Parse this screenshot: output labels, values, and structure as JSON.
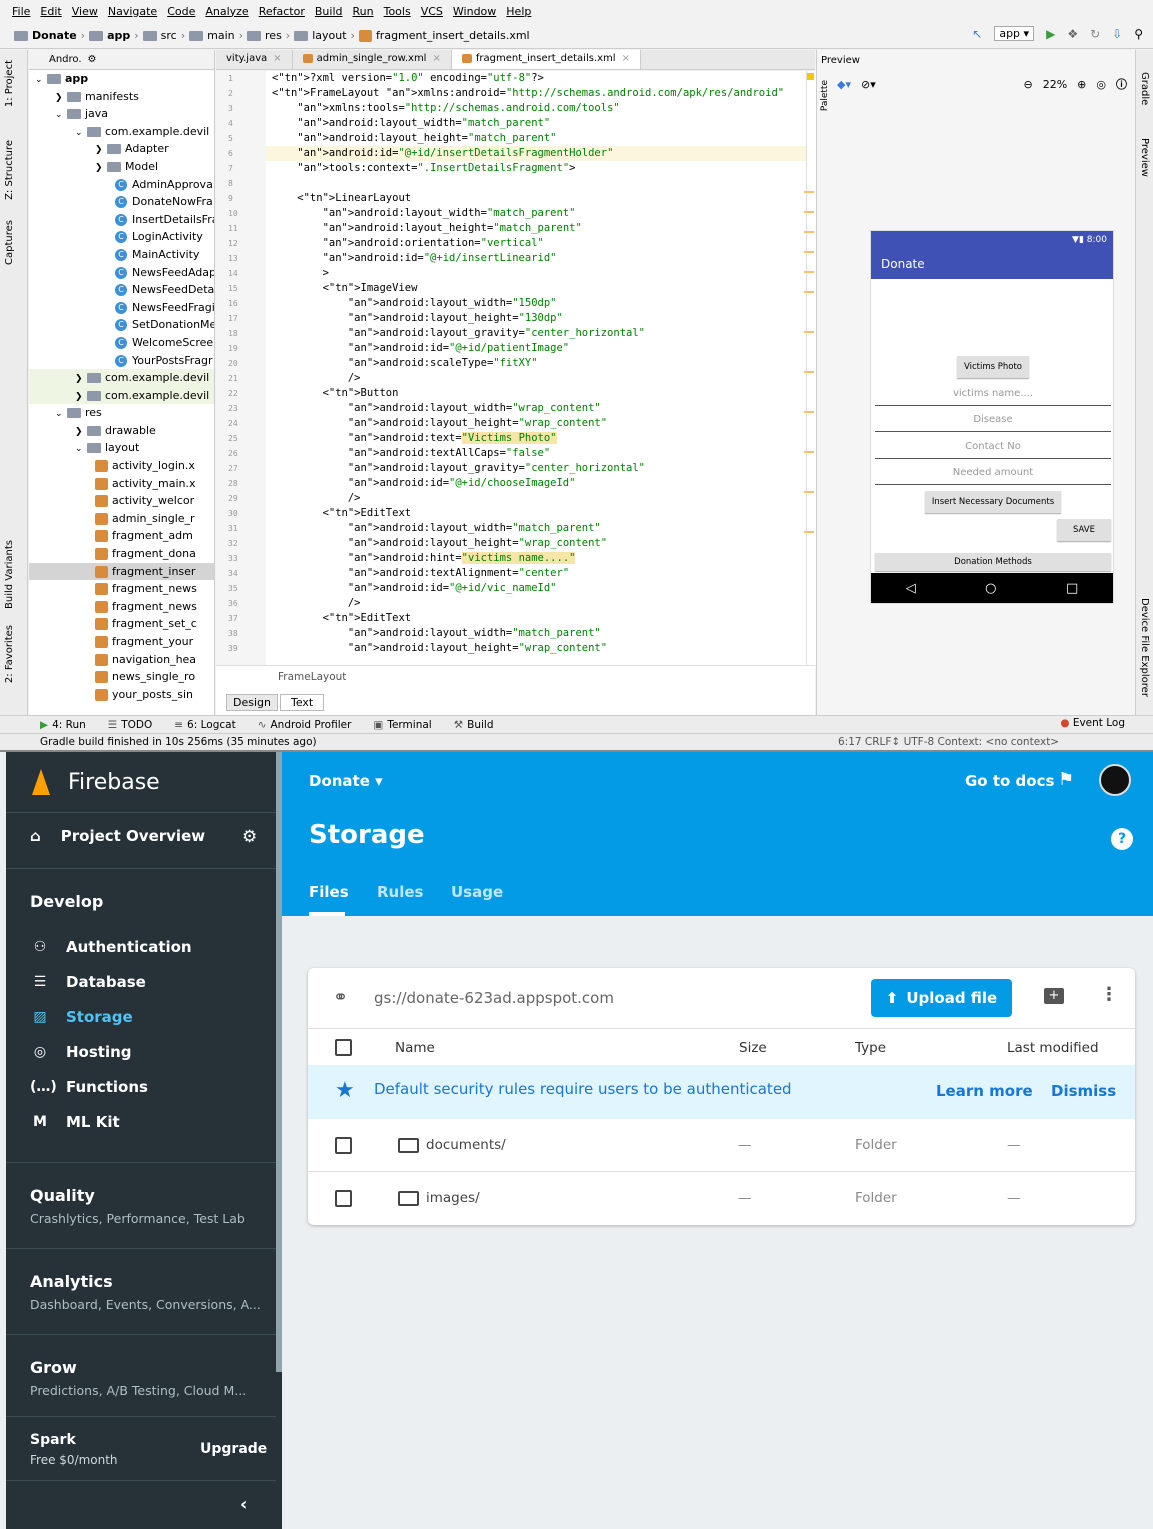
{
  "ide": {
    "menu": [
      "File",
      "Edit",
      "View",
      "Navigate",
      "Code",
      "Analyze",
      "Refactor",
      "Build",
      "Run",
      "Tools",
      "VCS",
      "Window",
      "Help"
    ],
    "breadcrumb": [
      "Donate",
      "app",
      "src",
      "main",
      "res",
      "layout",
      "fragment_insert_details.xml"
    ],
    "run_config": "app",
    "left_tools": [
      "1: Project",
      "Z: Structure",
      "Captures",
      "Build Variants",
      "2: Favorites"
    ],
    "right_tools": [
      "Gradle",
      "Preview",
      "Device File Explorer"
    ],
    "project_header": "Andro.",
    "tree": [
      {
        "label": "app",
        "d": 0,
        "t": "fold"
      },
      {
        "label": "manifests",
        "d": 1,
        "t": "fold"
      },
      {
        "label": "java",
        "d": 1,
        "t": "fold"
      },
      {
        "label": "com.example.devil",
        "d": 2,
        "t": "fold"
      },
      {
        "label": "Adapter",
        "d": 3,
        "t": "fold"
      },
      {
        "label": "Model",
        "d": 3,
        "t": "fold"
      },
      {
        "label": "AdminApprova",
        "d": 4,
        "t": "class"
      },
      {
        "label": "DonateNowFra",
        "d": 4,
        "t": "class"
      },
      {
        "label": "InsertDetailsFra",
        "d": 4,
        "t": "class"
      },
      {
        "label": "LoginActivity",
        "d": 4,
        "t": "class"
      },
      {
        "label": "MainActivity",
        "d": 4,
        "t": "class"
      },
      {
        "label": "NewsFeedAdap",
        "d": 4,
        "t": "class"
      },
      {
        "label": "NewsFeedDeta",
        "d": 4,
        "t": "class"
      },
      {
        "label": "NewsFeedFragi",
        "d": 4,
        "t": "class"
      },
      {
        "label": "SetDonationMe",
        "d": 4,
        "t": "class"
      },
      {
        "label": "WelcomeScree",
        "d": 4,
        "t": "class"
      },
      {
        "label": "YourPostsFragr",
        "d": 4,
        "t": "class"
      },
      {
        "label": "com.example.devil",
        "d": 2,
        "t": "fold",
        "hl": true
      },
      {
        "label": "com.example.devil",
        "d": 2,
        "t": "fold",
        "hl": true
      },
      {
        "label": "res",
        "d": 1,
        "t": "fold"
      },
      {
        "label": "drawable",
        "d": 2,
        "t": "fold"
      },
      {
        "label": "layout",
        "d": 2,
        "t": "fold"
      },
      {
        "label": "activity_login.x",
        "d": 3,
        "t": "xml"
      },
      {
        "label": "activity_main.x",
        "d": 3,
        "t": "xml"
      },
      {
        "label": "activity_welcor",
        "d": 3,
        "t": "xml"
      },
      {
        "label": "admin_single_r",
        "d": 3,
        "t": "xml"
      },
      {
        "label": "fragment_adm",
        "d": 3,
        "t": "xml"
      },
      {
        "label": "fragment_dona",
        "d": 3,
        "t": "xml"
      },
      {
        "label": "fragment_inser",
        "d": 3,
        "t": "xml",
        "sel": true
      },
      {
        "label": "fragment_news",
        "d": 3,
        "t": "xml"
      },
      {
        "label": "fragment_news",
        "d": 3,
        "t": "xml"
      },
      {
        "label": "fragment_set_c",
        "d": 3,
        "t": "xml"
      },
      {
        "label": "fragment_your",
        "d": 3,
        "t": "xml"
      },
      {
        "label": "navigation_hea",
        "d": 3,
        "t": "xml"
      },
      {
        "label": "news_single_ro",
        "d": 3,
        "t": "xml"
      },
      {
        "label": "your_posts_sin",
        "d": 3,
        "t": "xml"
      }
    ],
    "tabs": [
      "vity.java",
      "admin_single_row.xml",
      "fragment_insert_details.xml"
    ],
    "active_tab": 2,
    "code": [
      "<?xml version=\"1.0\" encoding=\"utf-8\"?>",
      "<FrameLayout xmlns:android=\"http://schemas.android.com/apk/res/android\"",
      "    xmlns:tools=\"http://schemas.android.com/tools\"",
      "    android:layout_width=\"match_parent\"",
      "    android:layout_height=\"match_parent\"",
      "    android:id=\"@+id/insertDetailsFragmentHolder\"",
      "    tools:context=\".InsertDetailsFragment\">",
      "",
      "    <LinearLayout",
      "        android:layout_width=\"match_parent\"",
      "        android:layout_height=\"match_parent\"",
      "        android:orientation=\"vertical\"",
      "        android:id=\"@+id/insertLinearid\"",
      "        >",
      "        <ImageView",
      "            android:layout_width=\"150dp\"",
      "            android:layout_height=\"130dp\"",
      "            android:layout_gravity=\"center_horizontal\"",
      "            android:id=\"@+id/patientImage\"",
      "            android:scaleType=\"fitXY\"",
      "            />",
      "        <Button",
      "            android:layout_width=\"wrap_content\"",
      "            android:layout_height=\"wrap_content\"",
      "            android:text=\"Victims Photo\"",
      "            android:textAllCaps=\"false\"",
      "            android:layout_gravity=\"center_horizontal\"",
      "            android:id=\"@+id/chooseImageId\"",
      "            />",
      "        <EditText",
      "            android:layout_width=\"match_parent\"",
      "            android:layout_height=\"wrap_content\"",
      "            android:hint=\"victims name....\"",
      "            android:textAlignment=\"center\"",
      "            android:id=\"@+id/vic_nameId\"",
      "            />",
      "        <EditText",
      "            android:layout_width=\"match_parent\"",
      "            android:layout_height=\"wrap_content\""
    ],
    "bottom_path": "FrameLayout",
    "design_tab": "Design",
    "text_tab": "Text",
    "preview_title": "Preview",
    "zoom": "22%",
    "phone": {
      "time": "8:00",
      "title": "Donate",
      "photo_btn": "Victims Photo",
      "fields": [
        "victims name....",
        "Disease",
        "Contact No",
        "Needed amount"
      ],
      "docs_btn": "Insert Necessary Documents",
      "save_btn": "SAVE",
      "methods_btn": "Donation Methods"
    },
    "tool_windows": [
      "4: Run",
      "TODO",
      "6: Logcat",
      "Android Profiler",
      "Terminal",
      "Build"
    ],
    "event_log": "Event Log",
    "status": "Gradle build finished in 10s 256ms (35 minutes ago)",
    "status_right": "6:17  CRLF↕  UTF-8  Context: <no context>"
  },
  "firebase": {
    "brand": "Firebase",
    "project_overview": "Project Overview",
    "develop": "Develop",
    "nav": [
      {
        "label": "Authentication",
        "icon": "people-icon",
        "glyph": "⚇"
      },
      {
        "label": "Database",
        "icon": "database-icon",
        "glyph": "☰"
      },
      {
        "label": "Storage",
        "icon": "storage-icon",
        "glyph": "▨",
        "active": true
      },
      {
        "label": "Hosting",
        "icon": "hosting-icon",
        "glyph": "◎"
      },
      {
        "label": "Functions",
        "icon": "functions-icon",
        "glyph": "(…)"
      },
      {
        "label": "ML Kit",
        "icon": "ml-kit-icon",
        "glyph": "M"
      }
    ],
    "groups": [
      {
        "title": "Quality",
        "sub": "Crashlytics, Performance, Test Lab"
      },
      {
        "title": "Analytics",
        "sub": "Dashboard, Events, Conversions, A..."
      },
      {
        "title": "Grow",
        "sub": "Predictions, A/B Testing, Cloud M..."
      }
    ],
    "plan_name": "Spark",
    "plan_price": "Free $0/month",
    "upgrade": "Upgrade",
    "project": "Donate",
    "go_to_docs": "Go to docs",
    "page_title": "Storage",
    "tabs": [
      "Files",
      "Rules",
      "Usage"
    ],
    "bucket": "gs://donate-623ad.appspot.com",
    "upload": "Upload file",
    "columns": [
      "Name",
      "Size",
      "Type",
      "Last modified"
    ],
    "banner": "Default security rules require users to be authenticated",
    "learn_more": "Learn more",
    "dismiss": "Dismiss",
    "rows": [
      {
        "name": "documents/",
        "size": "—",
        "type": "Folder",
        "modified": "—"
      },
      {
        "name": "images/",
        "size": "—",
        "type": "Folder",
        "modified": "—"
      }
    ],
    "colors": {
      "blue": "#039be5",
      "sidebar": "#263238",
      "accent": "#4fc3f7",
      "banner": "#e1f5fe"
    }
  }
}
